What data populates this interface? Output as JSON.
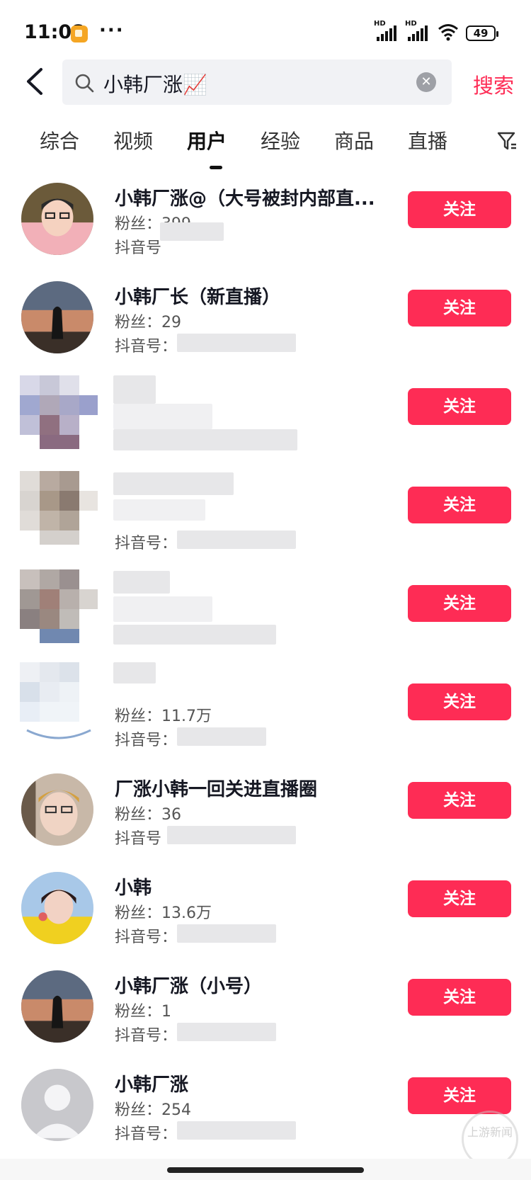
{
  "status_bar": {
    "time": "11:08",
    "more": "···",
    "signal_label": "HD",
    "battery": "49",
    "icons": [
      "app-badge-icon",
      "signal-icon",
      "wifi-icon",
      "battery-icon"
    ]
  },
  "search": {
    "query": "小韩厂涨📈",
    "submit_label": "搜索",
    "icons": [
      "back-arrow-icon",
      "search-icon",
      "clear-icon"
    ]
  },
  "tabs": [
    {
      "label": "综合"
    },
    {
      "label": "视频"
    },
    {
      "label": "用户",
      "active": true
    },
    {
      "label": "经验"
    },
    {
      "label": "商品"
    },
    {
      "label": "直播"
    }
  ],
  "filter_icon": "filter-icon",
  "fans_prefix": "粉丝：",
  "account_prefix": "抖音号：",
  "follow_label": "关注",
  "users": [
    {
      "name": "小韩厂涨@（大号被封内部直...",
      "fans": "粉丝：399",
      "account": "抖音号"
    },
    {
      "name": "小韩厂长（新直播）",
      "fans": "粉丝：29",
      "account": "抖音号："
    },
    {
      "name": "",
      "fans": "",
      "account": ""
    },
    {
      "name": "",
      "fans": "",
      "account": "抖音号："
    },
    {
      "name": "",
      "fans": "",
      "account": ""
    },
    {
      "name": "",
      "fans": "粉丝：11.7万",
      "account": "抖音号："
    },
    {
      "name": "厂涨小韩一回关进直播圈",
      "fans": "粉丝：36",
      "account": "抖音号"
    },
    {
      "name": "小韩",
      "fans": "粉丝：13.6万",
      "account": "抖音号："
    },
    {
      "name": "小韩厂涨（小号）",
      "fans": "粉丝：1",
      "account": "抖音号："
    },
    {
      "name": "小韩厂涨",
      "fans": "粉丝：254",
      "account": "抖音号："
    }
  ],
  "watermark": "上游新闻",
  "colors": {
    "accent": "#fe2c55",
    "search_bg": "#f1f2f5",
    "text_primary": "#161823",
    "text_secondary": "#555555"
  }
}
